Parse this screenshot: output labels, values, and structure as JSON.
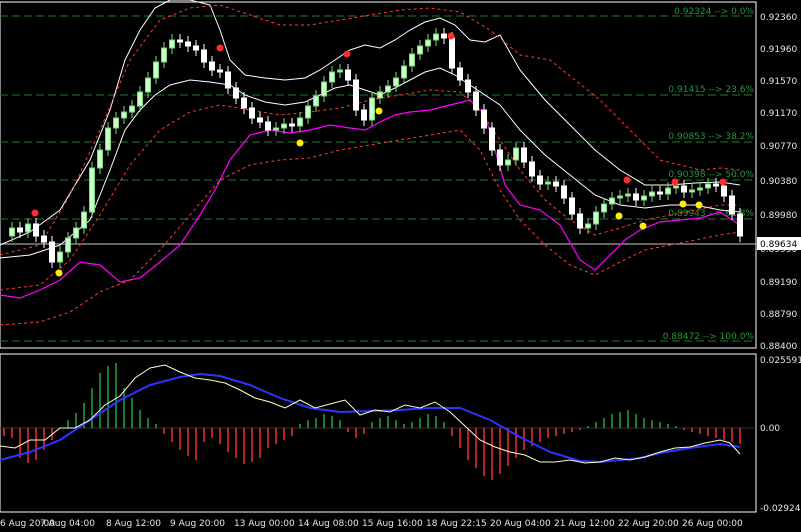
{
  "chart": {
    "main_price_axis": {
      "ticks": [
        "0.92360",
        "0.91960",
        "0.91570",
        "0.91170",
        "0.90770",
        "0.90380",
        "0.89980",
        "0.89590",
        "0.89190",
        "0.88790",
        "0.88400"
      ],
      "current_price": "0.89634"
    },
    "fib_levels": [
      {
        "label": "0.92324 --> 0.0%"
      },
      {
        "label": "0.91415 --> 23.6%"
      },
      {
        "label": "0.90853 --> 38.2%"
      },
      {
        "label": "0.90398 --> 50.0%"
      },
      {
        "label": "0.89943 --> 61.8%"
      },
      {
        "label": "0.88472 --> 100.0%"
      }
    ],
    "indicator_axis": {
      "ticks": [
        "0.025591",
        "0.00",
        "-0.029249"
      ]
    },
    "time_axis": {
      "labels": [
        "6 Aug 20:00",
        "7 Aug 04:00",
        "8 Aug 12:00",
        "9 Aug 20:00",
        "13 Aug 00:00",
        "14 Aug 08:00",
        "15 Aug 16:00",
        "18 Aug 22:15",
        "20 Aug 04:00",
        "21 Aug 12:00",
        "22 Aug 20:00",
        "26 Aug 00:00"
      ]
    },
    "colors": {
      "background": "#000000",
      "bull_candle": "#c8ffc8",
      "bear_candle": "#ffffff",
      "fib_line": "#1e7a2e",
      "upper_band": "#ffffff",
      "envelope": "#ff3b30",
      "ma": "#ff00ff",
      "histogram_up": "#1fa33a",
      "histogram_down": "#ff2a2a",
      "signal_line": "#2b35ff",
      "macd_line": "#ffffcc",
      "fractal_up": "#ff2a2a",
      "fractal_down": "#ffee00"
    }
  },
  "chart_data": {
    "type": "line",
    "title": "",
    "xlabel": "",
    "ylabel": "",
    "x": [
      "6 Aug 20:00",
      "7 Aug 04:00",
      "8 Aug 12:00",
      "9 Aug 20:00",
      "13 Aug 00:00",
      "14 Aug 08:00",
      "15 Aug 16:00",
      "18 Aug 22:15",
      "20 Aug 04:00",
      "21 Aug 12:00",
      "22 Aug 20:00",
      "26 Aug 00:00"
    ],
    "series": [
      {
        "values": [
          0.8985,
          0.894,
          0.911,
          0.919,
          0.908,
          0.916,
          0.911,
          0.9225,
          0.9,
          0.899,
          0.9025,
          0.9035
        ]
      }
    ],
    "ylim": [
      0.884,
      0.9236
    ],
    "grid": false
  }
}
